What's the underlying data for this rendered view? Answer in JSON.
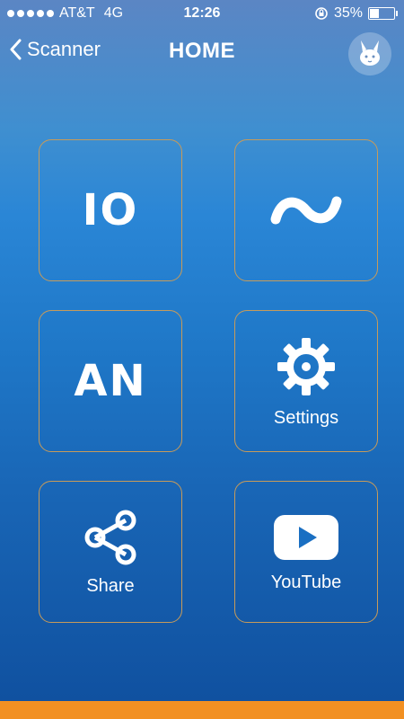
{
  "status": {
    "carrier": "AT&T",
    "network": "4G",
    "time": "12:26",
    "battery": "35%",
    "battery_level": 0.35
  },
  "nav": {
    "back_label": "Scanner",
    "title": "HOME",
    "avatar_icon": "bunny-icon"
  },
  "tiles": [
    {
      "glyph": "IO",
      "label": ""
    },
    {
      "glyph": "~",
      "icon": "wave-icon",
      "label": ""
    },
    {
      "glyph": "AN",
      "label": ""
    },
    {
      "icon": "gear-icon",
      "label": "Settings"
    },
    {
      "icon": "share-icon",
      "label": "Share"
    },
    {
      "icon": "youtube-icon",
      "label": "YouTube"
    }
  ],
  "colors": {
    "tile_border": "#c79b5a",
    "bottom_strip": "#f29022"
  }
}
